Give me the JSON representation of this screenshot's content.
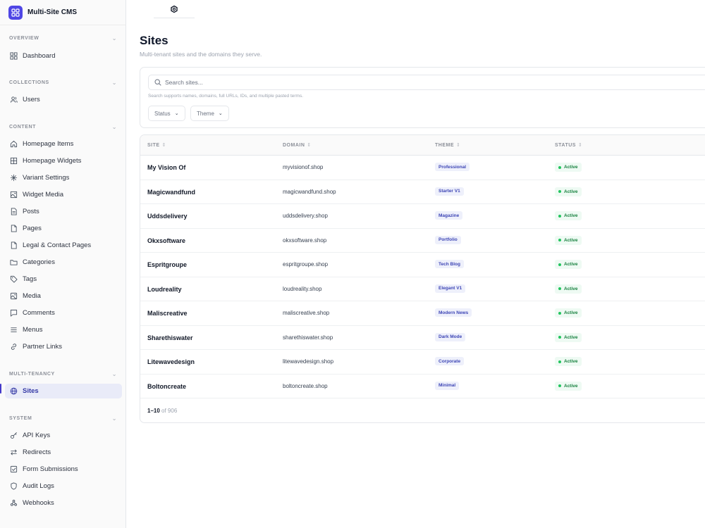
{
  "app": {
    "title": "Multi-Site CMS"
  },
  "sidebar": {
    "sections": [
      {
        "label": "OVERVIEW",
        "items": [
          {
            "label": "Dashboard",
            "icon": "dashboard-icon"
          }
        ]
      },
      {
        "label": "COLLECTIONS",
        "items": [
          {
            "label": "Users",
            "icon": "users-icon"
          }
        ]
      },
      {
        "label": "CONTENT",
        "items": [
          {
            "label": "Homepage Items",
            "icon": "home-icon"
          },
          {
            "label": "Homepage Widgets",
            "icon": "widgets-icon"
          },
          {
            "label": "Variant Settings",
            "icon": "sparkle-icon"
          },
          {
            "label": "Widget Media",
            "icon": "image-icon"
          },
          {
            "label": "Posts",
            "icon": "file-text-icon"
          },
          {
            "label": "Pages",
            "icon": "file-icon"
          },
          {
            "label": "Legal & Contact Pages",
            "icon": "file-icon"
          },
          {
            "label": "Categories",
            "icon": "folder-icon"
          },
          {
            "label": "Tags",
            "icon": "tag-icon"
          },
          {
            "label": "Media",
            "icon": "image-icon"
          },
          {
            "label": "Comments",
            "icon": "comment-icon"
          },
          {
            "label": "Menus",
            "icon": "menu-icon"
          },
          {
            "label": "Partner Links",
            "icon": "link-icon"
          }
        ]
      },
      {
        "label": "MULTI-TENANCY",
        "items": [
          {
            "label": "Sites",
            "icon": "globe-icon",
            "active": true
          }
        ]
      },
      {
        "label": "SYSTEM",
        "items": [
          {
            "label": "API Keys",
            "icon": "key-icon"
          },
          {
            "label": "Redirects",
            "icon": "redirect-icon"
          },
          {
            "label": "Form Submissions",
            "icon": "checkbox-icon"
          },
          {
            "label": "Audit Logs",
            "icon": "shield-icon"
          },
          {
            "label": "Webhooks",
            "icon": "webhook-icon"
          }
        ]
      }
    ]
  },
  "page": {
    "title": "Sites",
    "subtitle": "Multi-tenant sites and the domains they serve."
  },
  "search": {
    "placeholder": "Search sites...",
    "help": "Search supports names, domains, full URLs, IDs, and multiple pasted terms."
  },
  "filters": {
    "status_label": "Status",
    "theme_label": "Theme"
  },
  "table": {
    "columns": {
      "site": "SITE",
      "domain": "DOMAIN",
      "theme": "THEME",
      "status": "STATUS"
    },
    "rows": [
      {
        "site": "My Vision Of",
        "domain": "myvisionof.shop",
        "theme": "Professional",
        "status": "Active"
      },
      {
        "site": "Magicwandfund",
        "domain": "magicwandfund.shop",
        "theme": "Starter V1",
        "status": "Active"
      },
      {
        "site": "Uddsdelivery",
        "domain": "uddsdelivery.shop",
        "theme": "Magazine",
        "status": "Active"
      },
      {
        "site": "Okxsoftware",
        "domain": "okxsoftware.shop",
        "theme": "Portfolio",
        "status": "Active"
      },
      {
        "site": "Espritgroupe",
        "domain": "espritgroupe.shop",
        "theme": "Tech Blog",
        "status": "Active"
      },
      {
        "site": "Loudreality",
        "domain": "loudreality.shop",
        "theme": "Elegant V1",
        "status": "Active"
      },
      {
        "site": "Maliscreative",
        "domain": "maliscreative.shop",
        "theme": "Modern News",
        "status": "Active"
      },
      {
        "site": "Sharethiswater",
        "domain": "sharethiswater.shop",
        "theme": "Dark Mode",
        "status": "Active"
      },
      {
        "site": "Litewavedesign",
        "domain": "litewavedesign.shop",
        "theme": "Corporate",
        "status": "Active"
      },
      {
        "site": "Boltoncreate",
        "domain": "boltoncreate.shop",
        "theme": "Minimal",
        "status": "Active"
      }
    ],
    "pagination": {
      "range": "1–10",
      "of_text": "of 906"
    }
  },
  "colors": {
    "accent": "#4f46e5",
    "active_nav_bg": "#e9ebf8",
    "status_green": "#22c55e",
    "theme_badge_bg": "#eef0fb"
  }
}
